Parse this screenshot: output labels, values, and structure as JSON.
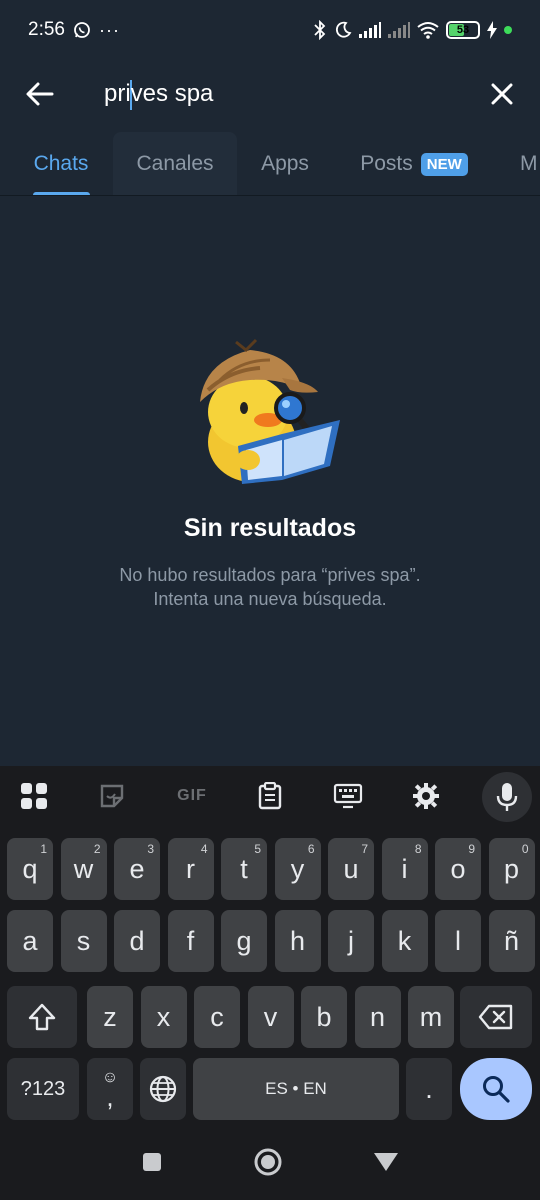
{
  "status": {
    "time": "2:56",
    "battery": "53"
  },
  "search": {
    "query_before_caret": "pri",
    "query_after_caret": "ves spa"
  },
  "tabs": [
    {
      "label": "Chats"
    },
    {
      "label": "Canales"
    },
    {
      "label": "Apps"
    },
    {
      "label": "Posts",
      "badge": "NEW"
    },
    {
      "label": "M"
    }
  ],
  "empty_state": {
    "title": "Sin resultados",
    "line1": "No hubo resultados para “prives spa”.",
    "line2": "Intenta una nueva búsqueda."
  },
  "keyboard": {
    "row1": [
      {
        "k": "q",
        "n": "1"
      },
      {
        "k": "w",
        "n": "2"
      },
      {
        "k": "e",
        "n": "3"
      },
      {
        "k": "r",
        "n": "4"
      },
      {
        "k": "t",
        "n": "5"
      },
      {
        "k": "y",
        "n": "6"
      },
      {
        "k": "u",
        "n": "7"
      },
      {
        "k": "i",
        "n": "8"
      },
      {
        "k": "o",
        "n": "9"
      },
      {
        "k": "p",
        "n": "0"
      }
    ],
    "row2": [
      "a",
      "s",
      "d",
      "f",
      "g",
      "h",
      "j",
      "k",
      "l",
      "ñ"
    ],
    "row3": [
      "z",
      "x",
      "c",
      "v",
      "b",
      "n",
      "m"
    ],
    "symbols_label": "?123",
    "comma": ",",
    "emoji_hint": "☺",
    "space_label": "ES • EN",
    "period": ".",
    "gif_label": "GIF"
  },
  "colors": {
    "accent": "#5aa8ee",
    "background": "#1d2733",
    "keyboard_bg": "#1a1b1e",
    "action_key": "#a9c7ff"
  }
}
